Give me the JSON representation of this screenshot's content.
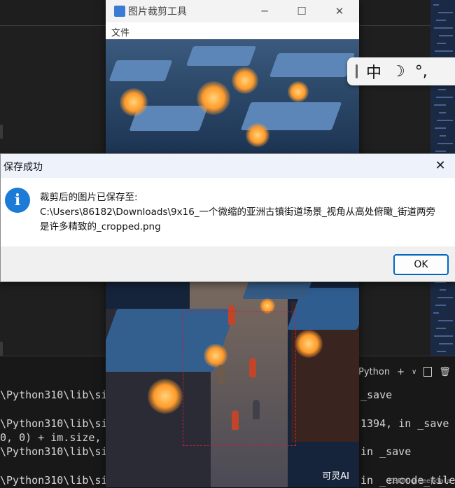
{
  "app_window": {
    "title": "图片裁剪工具",
    "menu": [
      "文件"
    ],
    "watermark": "可灵AI"
  },
  "dialog": {
    "title": "保存成功",
    "message_lines": [
      "裁剪后的图片已保存至:",
      "C:\\Users\\86182\\Downloads\\9x16_一个微缩的亚洲古镇街道场景_视角从高处俯瞰_街道两旁",
      "是许多精致的_cropped.png"
    ],
    "ok_label": "OK",
    "icon": "info-icon"
  },
  "ime_toolbar": {
    "items": [
      "中",
      "☽",
      "°,"
    ]
  },
  "terminal": {
    "left_lines": [
      "\\Python310\\lib\\si",
      "\\Python310\\lib\\si",
      "0, 0) + im.size,",
      "\\Python310\\lib\\si",
      "\\Python310\\lib\\si"
    ],
    "right_lines": [
      "_save",
      "1394, in _save",
      "",
      "in _save",
      "in _encode_tile"
    ],
    "shell_label": "Python",
    "credit": "CSDN @deepdata"
  }
}
